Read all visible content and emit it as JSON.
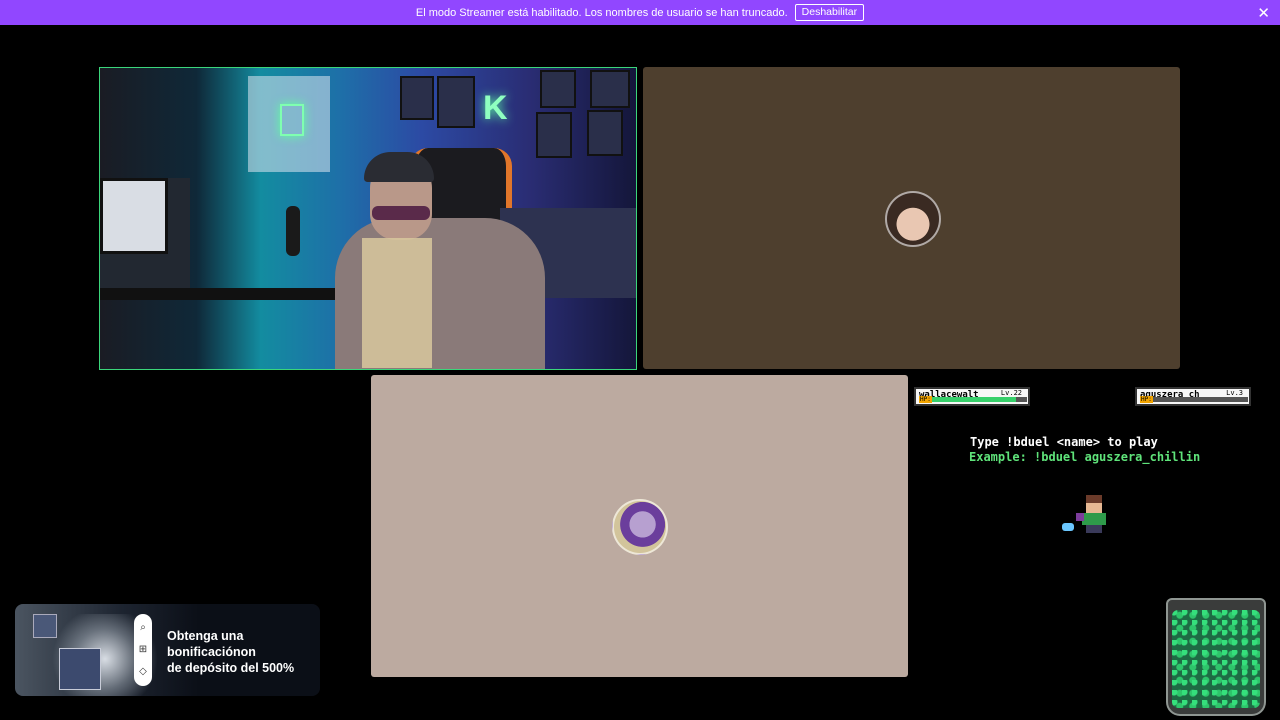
{
  "banner": {
    "message": "El modo Streamer está habilitado. Los nombres de usuario se han truncado.",
    "disable_label": "Deshabilitar",
    "close_glyph": "✕",
    "color": "#9147ff"
  },
  "tiles": {
    "tile2_color": "#4e3f2e",
    "tile3_color": "#bcaaa0"
  },
  "game": {
    "player1": {
      "name": "wallacewalt",
      "level": "Lv.22",
      "hp_label": "HP:",
      "hp_fraction": 0.9
    },
    "player2": {
      "name": "aguszera_ch",
      "level": "Lv.3",
      "hp_label": "HP:",
      "hp_fraction": 0.0
    },
    "instruction": "Type !bduel <name> to play",
    "example": "Example: !bduel aguszera_chillin",
    "accent_color": "#5fe37a"
  },
  "ad": {
    "line1": "Obtenga una",
    "line2": "bonificaciónon",
    "line3": "de depósito del 500%",
    "icons": [
      "search-icon",
      "gift-icon",
      "tag-icon"
    ]
  }
}
